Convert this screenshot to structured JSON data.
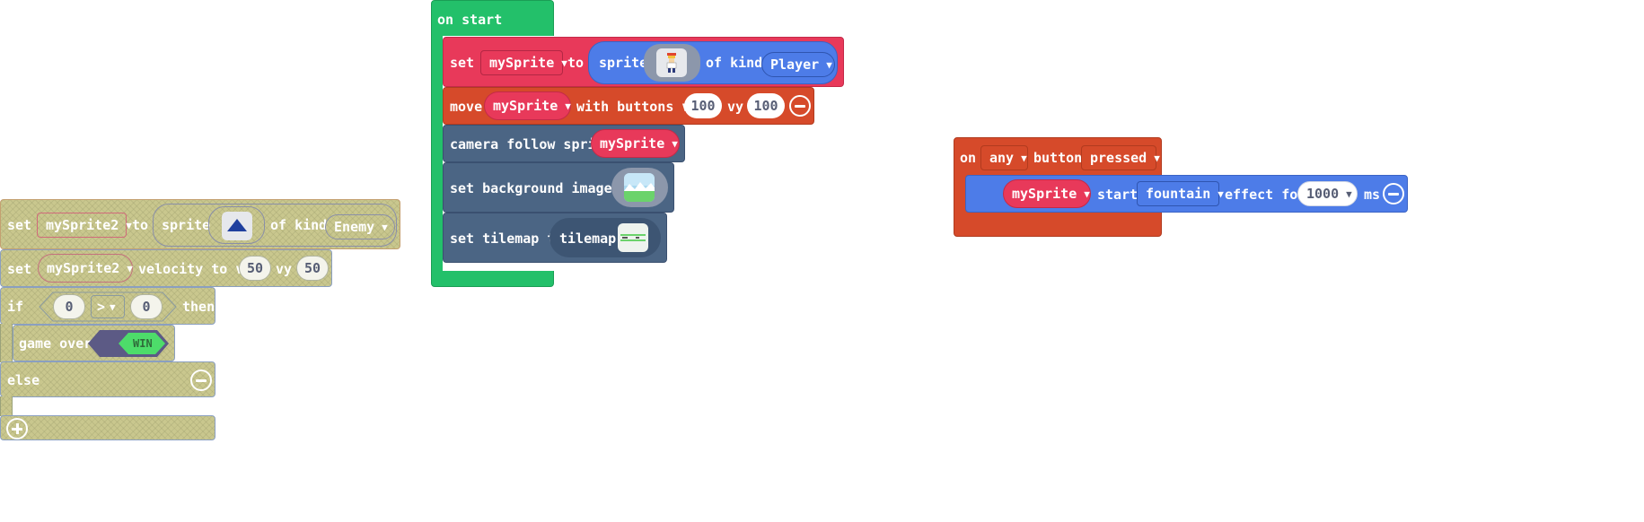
{
  "colors": {
    "event_green": "#23c06a",
    "sprite_red": "#e8395a",
    "controller_orange": "#d64a2a",
    "scene_slate": "#4b6584",
    "sprite_blue": "#4d7ce8",
    "disabled_fill": "#c9c78e"
  },
  "on_start": {
    "hat_label": "on start",
    "set_sprite": {
      "set_label": "set",
      "variable": "mySprite",
      "to_label": "to",
      "sprite_label": "sprite",
      "of_kind_label": "of kind",
      "kind": "Player",
      "image_icon": "player-sprite-image-icon"
    },
    "move_sprite": {
      "move_label": "move",
      "variable": "mySprite",
      "with_buttons_label": "with buttons vx",
      "vx": "100",
      "vy_label": "vy",
      "vy": "100"
    },
    "camera": {
      "label": "camera follow sprite",
      "variable": "mySprite"
    },
    "background": {
      "label": "set background image to",
      "image_icon": "background-image-icon"
    },
    "tilemap": {
      "label": "set tilemap to",
      "tilemap_label": "tilemap",
      "image_icon": "tilemap-image-icon"
    }
  },
  "disabled_stack": {
    "set_sprite2": {
      "set_label": "set",
      "variable": "mySprite2",
      "to_label": "to",
      "sprite_label": "sprite",
      "of_kind_label": "of kind",
      "kind": "Enemy",
      "image_icon": "enemy-sprite-image-icon"
    },
    "velocity": {
      "set_label": "set",
      "variable": "mySprite2",
      "velocity_label": "velocity to vx",
      "vx": "50",
      "vy_label": "vy",
      "vy": "50"
    },
    "if_block": {
      "if_label": "if",
      "left": "0",
      "operator": ">",
      "right": "0",
      "then_label": "then",
      "game_over_label": "game over",
      "win_label": "WIN",
      "else_label": "else"
    }
  },
  "button_event": {
    "on_label": "on",
    "button_value": "any",
    "button_label": "button",
    "event_value": "pressed",
    "effect": {
      "variable": "mySprite",
      "start_label": "start",
      "effect_name": "fountain",
      "effect_for_label": "effect for",
      "duration": "1000",
      "ms_label": "ms"
    }
  }
}
